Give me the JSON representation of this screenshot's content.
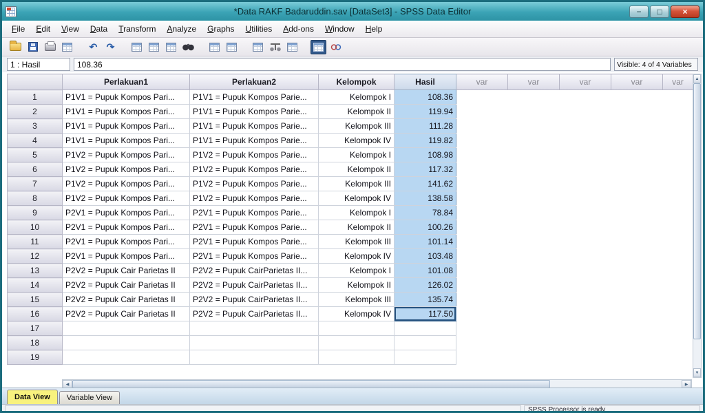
{
  "window": {
    "title": "*Data RAKF Badaruddin.sav [DataSet3] - SPSS Data Editor",
    "minimize": "−",
    "maximize": "□",
    "close": "×"
  },
  "menu": {
    "items": [
      "File",
      "Edit",
      "View",
      "Data",
      "Transform",
      "Analyze",
      "Graphs",
      "Utilities",
      "Add-ons",
      "Window",
      "Help"
    ]
  },
  "toolbar": {
    "icons": [
      {
        "name": "open-file-icon",
        "kind": "folder"
      },
      {
        "name": "save-icon",
        "kind": "floppy"
      },
      {
        "name": "print-icon",
        "kind": "printer"
      },
      {
        "name": "dialog-recall-icon",
        "kind": "table"
      },
      {
        "kind": "gap"
      },
      {
        "name": "undo-icon",
        "kind": "glyph",
        "glyph": "↶"
      },
      {
        "name": "redo-icon",
        "kind": "glyph",
        "glyph": "↷"
      },
      {
        "kind": "gap"
      },
      {
        "name": "goto-chart-icon",
        "kind": "table"
      },
      {
        "name": "goto-case-icon",
        "kind": "table"
      },
      {
        "name": "variables-icon",
        "kind": "table"
      },
      {
        "name": "find-icon",
        "kind": "binoculars"
      },
      {
        "kind": "gap"
      },
      {
        "name": "insert-cases-icon",
        "kind": "table"
      },
      {
        "name": "insert-variable-icon",
        "kind": "table"
      },
      {
        "kind": "gap"
      },
      {
        "name": "split-file-icon",
        "kind": "table"
      },
      {
        "name": "weight-cases-icon",
        "kind": "scale"
      },
      {
        "name": "select-cases-icon",
        "kind": "table"
      },
      {
        "kind": "gap"
      },
      {
        "name": "value-labels-icon",
        "kind": "table",
        "pressed": true
      },
      {
        "name": "use-variable-sets-icon",
        "kind": "rings"
      }
    ]
  },
  "cellref": {
    "cell_label": "1 : Hasil",
    "cell_value": "108.36",
    "visible_info": "Visible: 4 of 4 Variables"
  },
  "grid": {
    "columns": [
      {
        "label": "Perlakuan1",
        "type": "data"
      },
      {
        "label": "Perlakuan2",
        "type": "data"
      },
      {
        "label": "Kelompok",
        "type": "data"
      },
      {
        "label": "Hasil",
        "type": "data",
        "selected": true
      },
      {
        "label": "var",
        "type": "placeholder"
      },
      {
        "label": "var",
        "type": "placeholder"
      },
      {
        "label": "var",
        "type": "placeholder"
      },
      {
        "label": "var",
        "type": "placeholder"
      },
      {
        "label": "var",
        "type": "placeholder"
      }
    ],
    "rows": [
      {
        "n": "1",
        "perlakuan1": "P1V1 = Pupuk Kompos Pari...",
        "perlakuan2": "P1V1 = Pupuk Kompos Parie...",
        "kelompok": "Kelompok I",
        "hasil": "108.36"
      },
      {
        "n": "2",
        "perlakuan1": "P1V1 = Pupuk Kompos Pari...",
        "perlakuan2": "P1V1 = Pupuk Kompos Parie...",
        "kelompok": "Kelompok II",
        "hasil": "119.94"
      },
      {
        "n": "3",
        "perlakuan1": "P1V1 = Pupuk Kompos Pari...",
        "perlakuan2": "P1V1 = Pupuk Kompos Parie...",
        "kelompok": "Kelompok III",
        "hasil": "111.28"
      },
      {
        "n": "4",
        "perlakuan1": "P1V1 = Pupuk Kompos Pari...",
        "perlakuan2": "P1V1 = Pupuk Kompos Parie...",
        "kelompok": "Kelompok IV",
        "hasil": "119.82"
      },
      {
        "n": "5",
        "perlakuan1": "P1V2 = Pupuk Kompos Pari...",
        "perlakuan2": "P1V2 = Pupuk Kompos Parie...",
        "kelompok": "Kelompok I",
        "hasil": "108.98"
      },
      {
        "n": "6",
        "perlakuan1": "P1V2 = Pupuk Kompos Pari...",
        "perlakuan2": "P1V2 = Pupuk Kompos Parie...",
        "kelompok": "Kelompok II",
        "hasil": "117.32"
      },
      {
        "n": "7",
        "perlakuan1": "P1V2 = Pupuk Kompos Pari...",
        "perlakuan2": "P1V2 = Pupuk Kompos Parie...",
        "kelompok": "Kelompok III",
        "hasil": "141.62"
      },
      {
        "n": "8",
        "perlakuan1": "P1V2 = Pupuk Kompos Pari...",
        "perlakuan2": "P1V2 = Pupuk Kompos Parie...",
        "kelompok": "Kelompok IV",
        "hasil": "138.58"
      },
      {
        "n": "9",
        "perlakuan1": "P2V1 = Pupuk Kompos Pari...",
        "perlakuan2": "P2V1 = Pupuk Kompos Parie...",
        "kelompok": "Kelompok I",
        "hasil": "78.84"
      },
      {
        "n": "10",
        "perlakuan1": "P2V1 = Pupuk Kompos Pari...",
        "perlakuan2": "P2V1 = Pupuk Kompos Parie...",
        "kelompok": "Kelompok II",
        "hasil": "100.26"
      },
      {
        "n": "11",
        "perlakuan1": "P2V1 = Pupuk Kompos Pari...",
        "perlakuan2": "P2V1 = Pupuk Kompos Parie...",
        "kelompok": "Kelompok III",
        "hasil": "101.14"
      },
      {
        "n": "12",
        "perlakuan1": "P2V1 = Pupuk Kompos Pari...",
        "perlakuan2": "P2V1 = Pupuk Kompos Parie...",
        "kelompok": "Kelompok IV",
        "hasil": "103.48"
      },
      {
        "n": "13",
        "perlakuan1": "P2V2 = Pupuk Cair Parietas II",
        "perlakuan2": "P2V2 = Pupuk CairParietas II...",
        "kelompok": "Kelompok I",
        "hasil": "101.08"
      },
      {
        "n": "14",
        "perlakuan1": "P2V2 = Pupuk Cair Parietas II",
        "perlakuan2": "P2V2 = Pupuk CairParietas II...",
        "kelompok": "Kelompok II",
        "hasil": "126.02"
      },
      {
        "n": "15",
        "perlakuan1": "P2V2 = Pupuk Cair Parietas II",
        "perlakuan2": "P2V2 = Pupuk CairParietas II...",
        "kelompok": "Kelompok III",
        "hasil": "135.74"
      },
      {
        "n": "16",
        "perlakuan1": "P2V2 = Pupuk Cair Parietas II",
        "perlakuan2": "P2V2 = Pupuk CairParietas II...",
        "kelompok": "Kelompok IV",
        "hasil": "117.50"
      }
    ],
    "empty_rows": [
      "17",
      "18",
      "19"
    ],
    "selected_column": "Hasil",
    "active_cell": {
      "row": "16",
      "column": "Hasil",
      "value": "117.50"
    }
  },
  "tabs": [
    {
      "label": "Data View",
      "active": true
    },
    {
      "label": "Variable View",
      "active": false
    }
  ],
  "scrollbar": {
    "up": "▲",
    "down": "▼",
    "left": "◀",
    "right": "▶"
  },
  "status": {
    "message": "SPSS Processor is ready"
  },
  "colors": {
    "titlebar": "#3ba3b5",
    "close_button": "#c2462c",
    "selection_fill": "#b8d7f2",
    "active_tab": "#f8f27e",
    "header_fill": "#dcdce8"
  }
}
